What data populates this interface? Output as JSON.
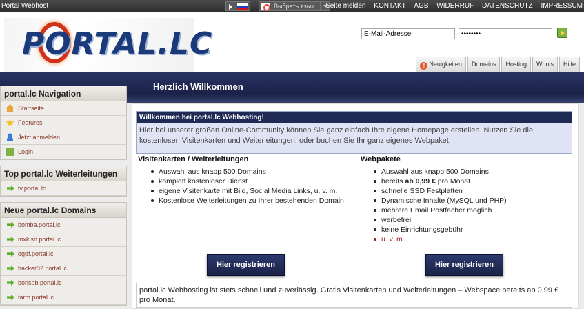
{
  "topbar": {
    "brand": "Portal Webhost",
    "language_select": "Выбрать язык",
    "links": [
      "Seite melden",
      "KONTAKT",
      "AGB",
      "WIDERRUF",
      "DATENSCHUTZ",
      "IMPRESSUM"
    ]
  },
  "logo": {
    "text": "PORTAL.LC"
  },
  "login": {
    "email_value": "E-Mail-Adresse",
    "password_value": "••••••••"
  },
  "tabs": [
    "Neuigkeiten",
    "Domains",
    "Hosting",
    "Whois",
    "Hilfe"
  ],
  "banner": {
    "title": "Herzlich Willkommen"
  },
  "sidebar": {
    "navigation": {
      "title": "portal.lc Navigation",
      "items": [
        {
          "label": "Startseite",
          "icon": "home-icon"
        },
        {
          "label": "Features",
          "icon": "star-icon"
        },
        {
          "label": "Jetzt anmelden",
          "icon": "user-icon"
        },
        {
          "label": "Login",
          "icon": "login-icon"
        }
      ]
    },
    "forwardings": {
      "title": "Top portal.lc Weiterleitungen",
      "items": [
        "tv.portal.lc"
      ]
    },
    "domains": {
      "title": "Neue portal.lc Domains",
      "items": [
        "bomba.portal.lc",
        "mxklsn.portal.lc",
        "dgdf.portal.lc",
        "hacker32.portal.lc",
        "borisbb.portal.lc",
        "farm.portal.lc"
      ]
    }
  },
  "welcome_box": {
    "title": "Willkommen bei portal.lc Webhosting!",
    "text": "Hier bei unserer großen Online-Community können Sie ganz einfach Ihre eigene Homepage erstellen. Nutzen Sie die kostenlosen Visitenkarten und Weiterleitungen, oder buchen Sie Ihr ganz eigenes Webpaket."
  },
  "left_column": {
    "title": "Visitenkarten / Weiterleitungen",
    "items": [
      "Auswahl aus knapp 500 Domains",
      "komplett kostenloser Dienst",
      "eigene Visitenkarte mit Bild, Social Media Links, u. v. m.",
      "Kostenlose Weiterleitungen zu Ihrer bestehenden Domain"
    ],
    "button": "Hier registrieren"
  },
  "right_column": {
    "title": "Webpakete",
    "items": [
      {
        "pre": "Auswahl aus knapp 500 Domains",
        "bold": "",
        "post": ""
      },
      {
        "pre": "bereits ",
        "bold": "ab 0,99 €",
        "post": " pro Monat"
      },
      {
        "pre": "schnelle SSD Festplatten",
        "bold": "",
        "post": ""
      },
      {
        "pre": "Dynamische Inhalte (MySQL und PHP)",
        "bold": "",
        "post": ""
      },
      {
        "pre": "mehrere Email Postfächer möglich",
        "bold": "",
        "post": ""
      },
      {
        "pre": "werbefrei",
        "bold": "",
        "post": ""
      },
      {
        "pre": "keine Einrichtungsgebühr",
        "bold": "",
        "post": ""
      },
      {
        "pre": "u. v. m.",
        "bold": "",
        "post": ""
      }
    ],
    "button": "Hier registrieren"
  },
  "footer_text": "portal.lc Webhosting ist stets schnell und zuverlässig. Gratis Visitenkarten und Weiterleitungen – Webspace bereits ab 0,99 € pro Monat."
}
